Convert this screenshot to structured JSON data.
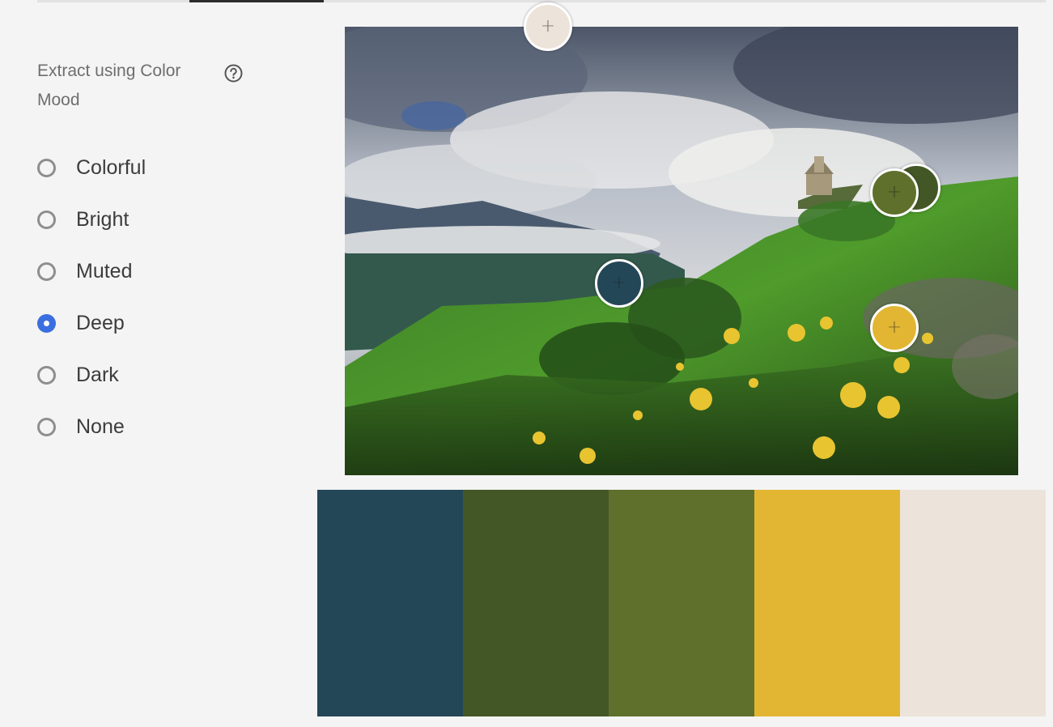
{
  "tabs": {
    "active_index": 1
  },
  "sidebar": {
    "heading": "Extract using Color Mood",
    "help_icon": "question-circle-icon",
    "moods": [
      {
        "label": "Colorful",
        "checked": false
      },
      {
        "label": "Bright",
        "checked": false
      },
      {
        "label": "Muted",
        "checked": false
      },
      {
        "label": "Deep",
        "checked": true
      },
      {
        "label": "Dark",
        "checked": false
      },
      {
        "label": "None",
        "checked": false
      }
    ]
  },
  "colors": {
    "background": "#f4f4f4",
    "radio_selected": "#3b6fe0",
    "radio_unselected": "#8e8e8e"
  },
  "image": {
    "description_icon": "landscape-photo",
    "pickers": [
      {
        "name": "picker-beige",
        "color": "#ece3da"
      },
      {
        "name": "picker-dark-olive",
        "color": "#435726"
      },
      {
        "name": "picker-olive",
        "color": "#5e702b"
      },
      {
        "name": "picker-navy",
        "color": "#244758"
      },
      {
        "name": "picker-yellow",
        "color": "#e2b633"
      }
    ]
  },
  "palette": {
    "swatches": [
      {
        "name": "swatch-navy",
        "color": "#244758"
      },
      {
        "name": "swatch-dark-olive",
        "color": "#435726"
      },
      {
        "name": "swatch-olive",
        "color": "#5e702b"
      },
      {
        "name": "swatch-yellow",
        "color": "#e2b633"
      },
      {
        "name": "swatch-beige",
        "color": "#ece3da"
      }
    ]
  }
}
